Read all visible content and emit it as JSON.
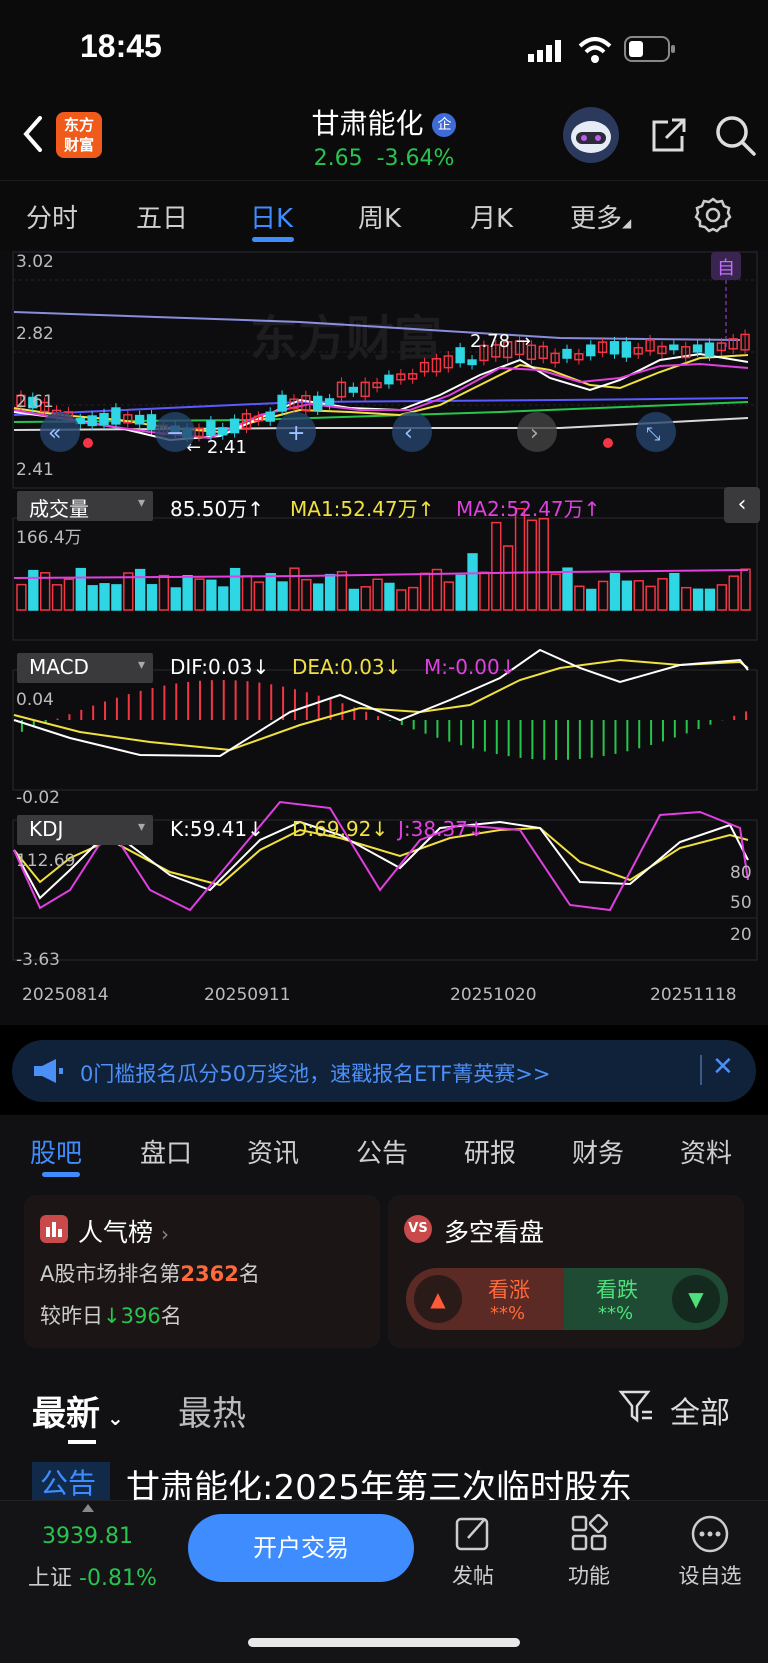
{
  "status_bar": {
    "time": "18:45"
  },
  "header": {
    "logo_text": "东方\n财富",
    "stock_name": "甘肃能化",
    "badge": "企",
    "price": "2.65",
    "change": "-3.64%"
  },
  "period_tabs": [
    "分时",
    "五日",
    "日K",
    "周K",
    "月K",
    "更多"
  ],
  "active_period": "日K",
  "kline": {
    "price_labels": [
      "3.02",
      "2.82",
      "2.61",
      "2.41"
    ],
    "high_marker": "2.78",
    "low_marker": "2.41",
    "self_select_marker": "自",
    "watermark": "东方财富"
  },
  "volume": {
    "button": "成交量",
    "value": "85.50万",
    "ma1": "MA1:52.47万",
    "ma2": "MA2:52.47万",
    "axis_top": "166.4万"
  },
  "macd": {
    "button": "MACD",
    "dif": "DIF:0.03",
    "dea": "DEA:0.03",
    "m": "M:-0.00",
    "axis_top": "0.04",
    "axis_bottom": "-0.02"
  },
  "kdj": {
    "button": "KDJ",
    "k": "K:59.41",
    "d": "D:69.92",
    "j": "J:38.37",
    "axis_top": "112.69",
    "axis_bottom": "-3.63",
    "right_ticks": [
      "80",
      "50",
      "20"
    ]
  },
  "x_dates": [
    "20250814",
    "20250911",
    "20251020",
    "20251118"
  ],
  "banner": {
    "text": "0门槛报名瓜分50万奖池，速戳报名ETF菁英赛>>"
  },
  "sub_tabs": [
    "股吧",
    "盘口",
    "资讯",
    "公告",
    "研报",
    "财务",
    "资料"
  ],
  "active_sub_tab": "股吧",
  "popularity": {
    "title": "人气榜",
    "rank_prefix": "A股市场排名第",
    "rank": "2362",
    "rank_suffix": "名",
    "compare_prefix": "较昨日",
    "compare_value": "396",
    "compare_suffix": "名"
  },
  "bull_bear": {
    "title": "多空看盘",
    "bull_label": "看涨",
    "bull_value": "**%",
    "bear_label": "看跌",
    "bear_value": "**%"
  },
  "feed": {
    "tab_latest": "最新",
    "tab_hot": "最热",
    "filter": "全部",
    "post_tag": "公告",
    "post_title": "甘肃能化:2025年第三次临时股东"
  },
  "bottom_bar": {
    "index_value": "3939.81",
    "index_name": "上证",
    "index_change": "-0.81%",
    "trade_button": "开户交易",
    "nav": [
      "发帖",
      "功能",
      "设自选"
    ]
  },
  "colors": {
    "up": "#f23645",
    "down": "#27c54e",
    "accent": "#3f8cff",
    "cyan": "#2fd6e4",
    "yellow": "#f0e040",
    "magenta": "#e040e0"
  }
}
